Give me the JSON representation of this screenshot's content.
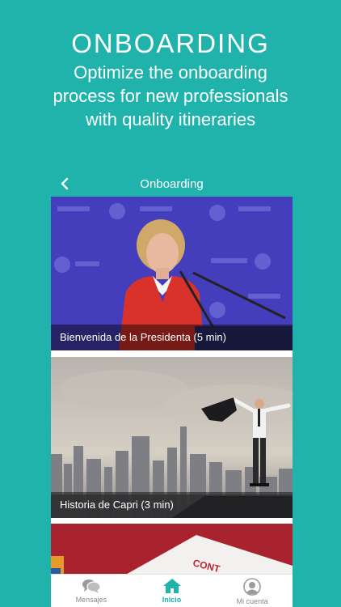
{
  "hero": {
    "title": "ONBOARDING",
    "subtitle_line1": "Optimize the onboarding",
    "subtitle_line2": "process for new professionals",
    "subtitle_line3": "with quality itineraries"
  },
  "appbar": {
    "title": "Onboarding",
    "back_icon": "chevron-left-icon"
  },
  "feed": {
    "items": [
      {
        "caption": "Bienvenida de la Presidenta (5 min)"
      },
      {
        "caption": "Historia de Capri (3 min)"
      },
      {
        "caption": ""
      }
    ]
  },
  "tabbar": {
    "tabs": [
      {
        "label": "Mensajes",
        "icon": "chat-bubbles-icon",
        "active": false
      },
      {
        "label": "Inicio",
        "icon": "home-icon",
        "active": true
      },
      {
        "label": "Mi cuenta",
        "icon": "user-circle-icon",
        "active": false
      }
    ]
  },
  "colors": {
    "brand_teal": "#1fb3ab",
    "inactive_gray": "#8a8a8a"
  }
}
